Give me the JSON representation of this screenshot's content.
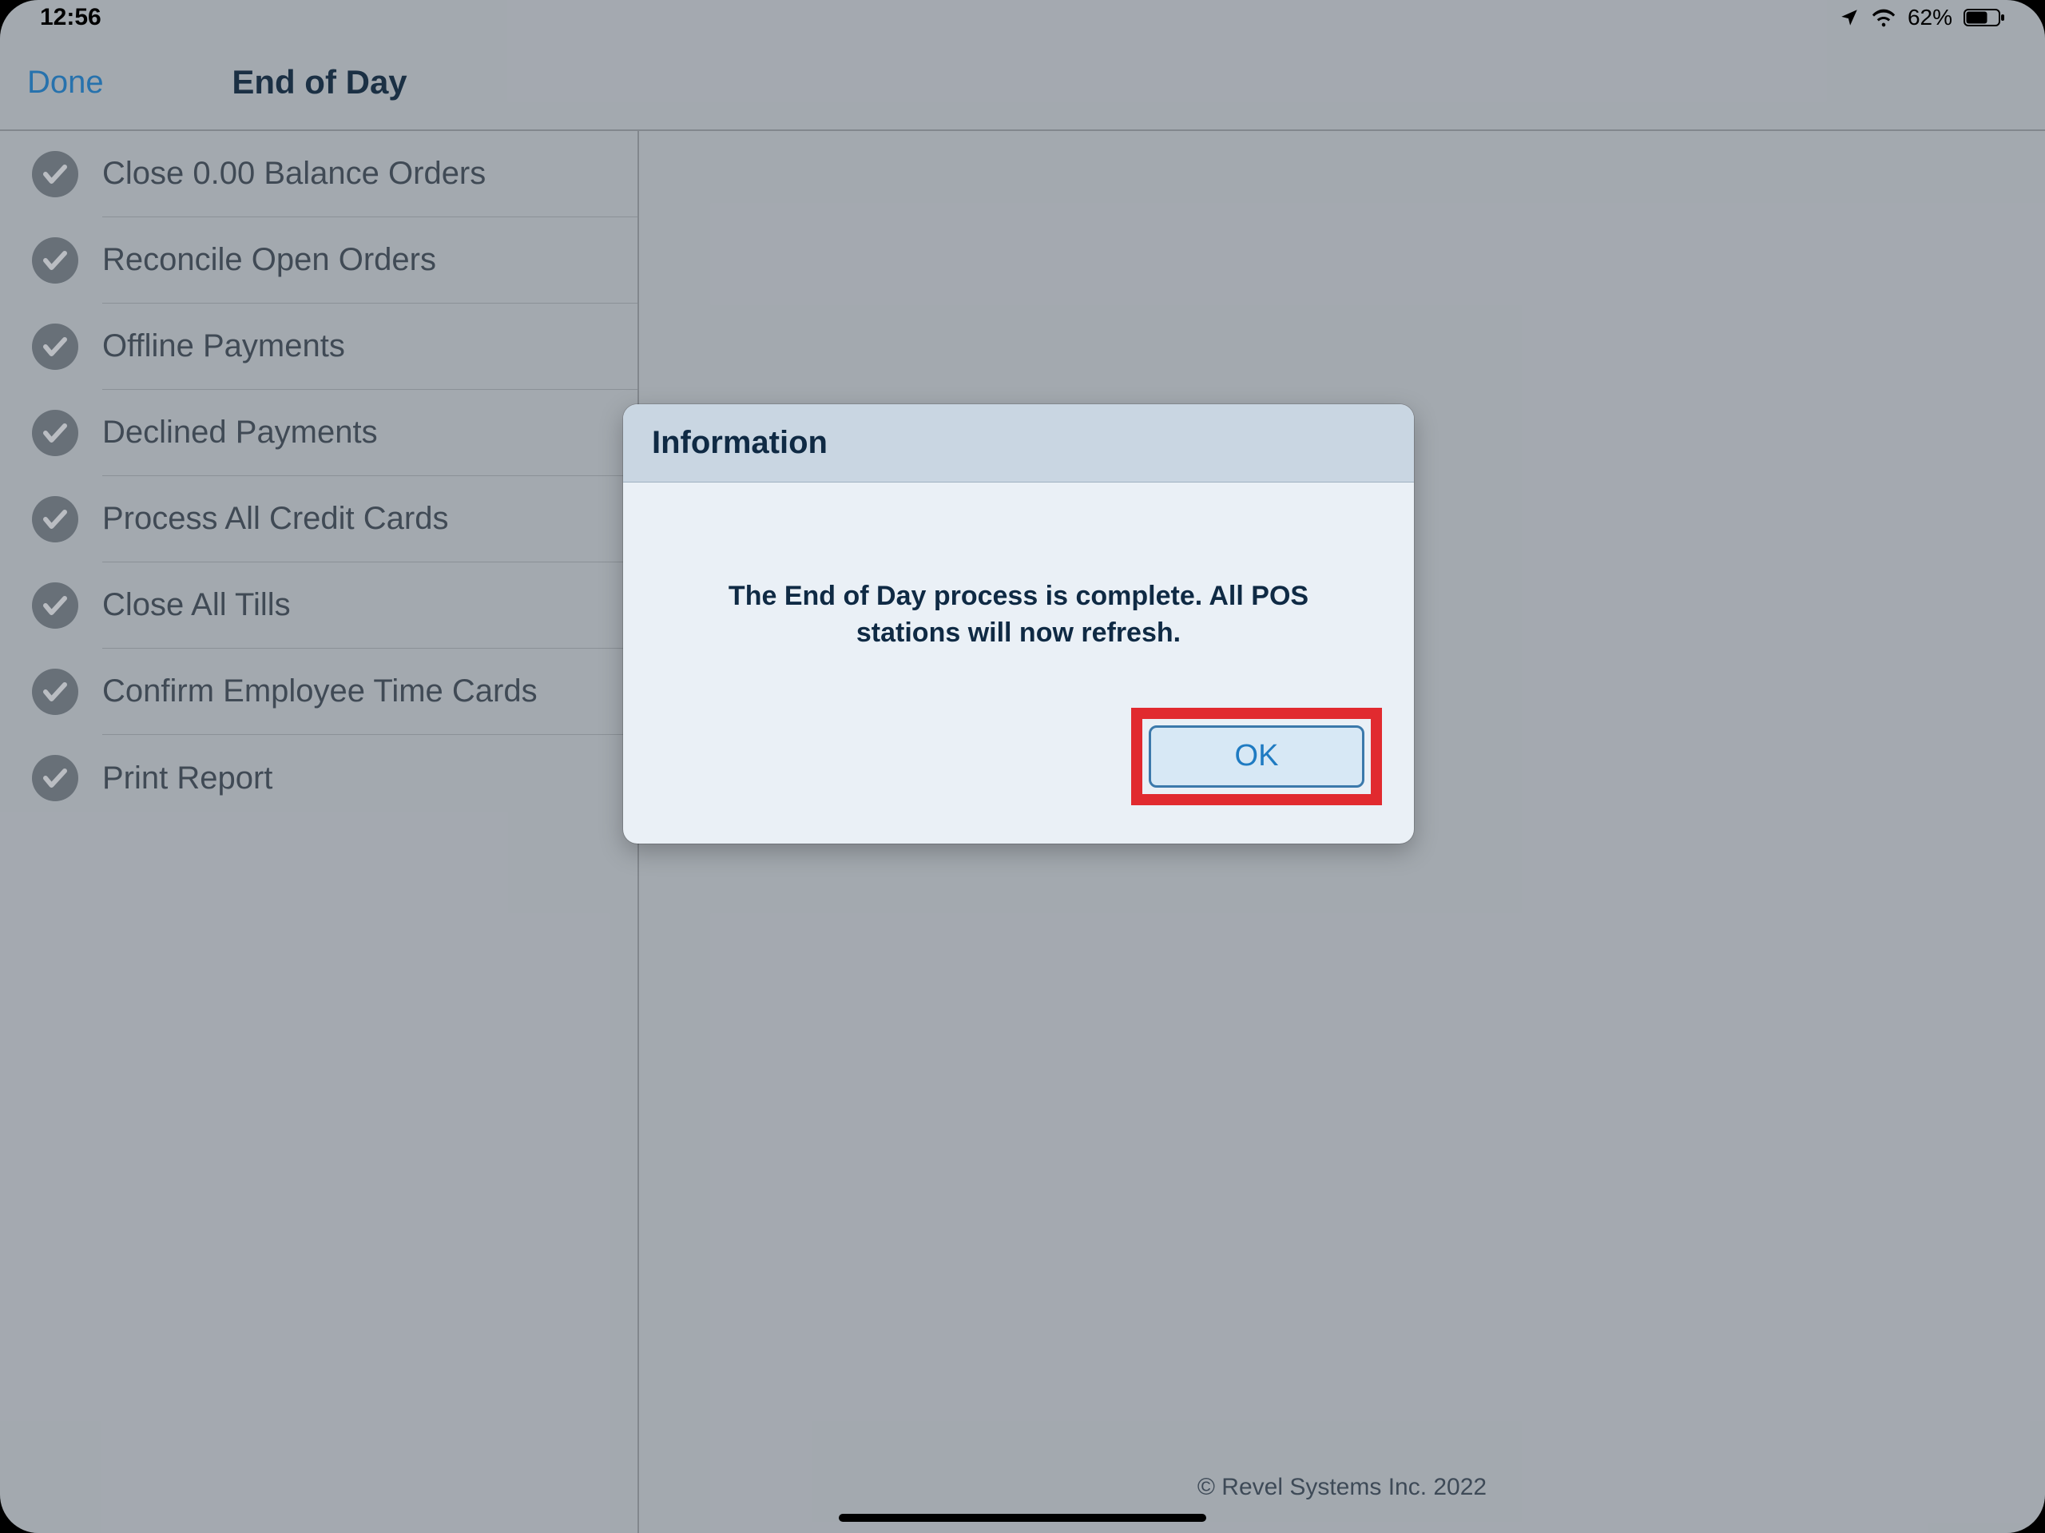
{
  "status": {
    "time": "12:56",
    "battery_pct": "62%"
  },
  "header": {
    "done_label": "Done",
    "title": "End of Day"
  },
  "sidebar": {
    "items": [
      {
        "label": "Close 0.00 Balance Orders"
      },
      {
        "label": "Reconcile Open Orders"
      },
      {
        "label": "Offline Payments"
      },
      {
        "label": "Declined Payments"
      },
      {
        "label": "Process All Credit Cards"
      },
      {
        "label": "Close All Tills"
      },
      {
        "label": "Confirm Employee Time Cards"
      },
      {
        "label": "Print Report"
      }
    ]
  },
  "modal": {
    "title": "Information",
    "message": "The End of Day process is complete. All POS stations will now refresh.",
    "ok_label": "OK"
  },
  "footer": {
    "copyright": "© Revel Systems Inc. 2022"
  }
}
